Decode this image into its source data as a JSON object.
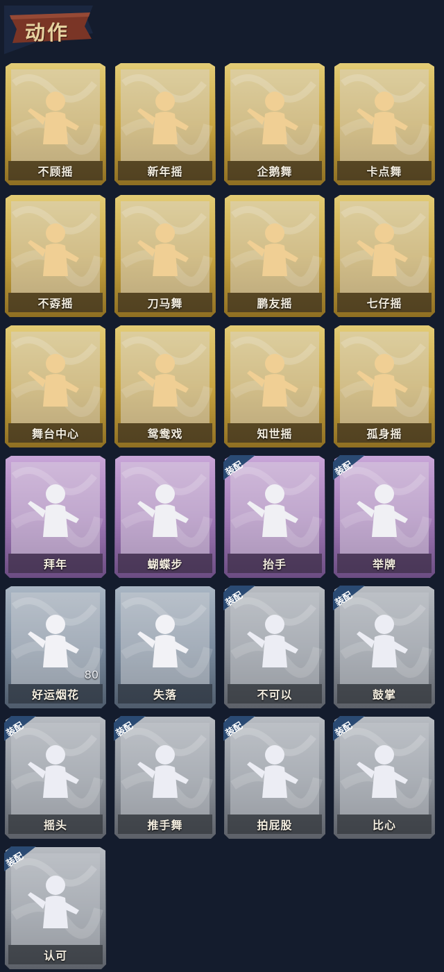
{
  "header": {
    "title": "动作"
  },
  "badge_text": "装配",
  "cards": [
    {
      "label": "不顾摇",
      "tier": "gold",
      "equipped": false,
      "icon": "dance-pose-arm-up-icon"
    },
    {
      "label": "新年摇",
      "tier": "gold",
      "equipped": false,
      "icon": "dance-pose-hands-clasp-icon"
    },
    {
      "label": "企鹅舞",
      "tier": "gold",
      "equipped": false,
      "icon": "dance-pose-penguin-icon"
    },
    {
      "label": "卡点舞",
      "tier": "gold",
      "equipped": false,
      "icon": "dance-pose-point-up-icon"
    },
    {
      "label": "不孬摇",
      "tier": "gold",
      "equipped": false,
      "icon": "dance-pose-wave-icon"
    },
    {
      "label": "刀马舞",
      "tier": "gold",
      "equipped": false,
      "icon": "dance-pose-cross-arms-icon"
    },
    {
      "label": "鹏友摇",
      "tier": "gold",
      "equipped": false,
      "icon": "dance-pose-wings-icon"
    },
    {
      "label": "七仔摇",
      "tier": "gold",
      "equipped": false,
      "icon": "dance-pose-arm-bent-icon"
    },
    {
      "label": "舞台中心",
      "tier": "gold",
      "equipped": false,
      "icon": "dance-pose-sparkle-icon"
    },
    {
      "label": "鸳鸯戏",
      "tier": "gold",
      "equipped": false,
      "icon": "dance-pose-notes-icon"
    },
    {
      "label": "知世摇",
      "tier": "gold",
      "equipped": false,
      "icon": "dance-pose-flame-icon"
    },
    {
      "label": "孤身摇",
      "tier": "gold",
      "equipped": false,
      "icon": "dance-pose-stars-icon"
    },
    {
      "label": "拜年",
      "tier": "purple",
      "equipped": false,
      "icon": "new-year-greeting-icon"
    },
    {
      "label": "蝴蝶步",
      "tier": "purple",
      "equipped": false,
      "icon": "butterfly-step-icon"
    },
    {
      "label": "抬手",
      "tier": "purple",
      "equipped": true,
      "icon": "raise-hand-icon"
    },
    {
      "label": "举牌",
      "tier": "purple",
      "equipped": true,
      "icon": "hold-sign-icon"
    },
    {
      "label": "好运烟花",
      "tier": "blue",
      "equipped": false,
      "icon": "firework-icon",
      "count": "80"
    },
    {
      "label": "失落",
      "tier": "blue",
      "equipped": false,
      "icon": "crawling-figure-icon"
    },
    {
      "label": "不可以",
      "tier": "gray",
      "equipped": true,
      "icon": "finger-wag-icon"
    },
    {
      "label": "鼓掌",
      "tier": "gray",
      "equipped": true,
      "icon": "clap-icon"
    },
    {
      "label": "摇头",
      "tier": "gray",
      "equipped": true,
      "icon": "shake-head-icon"
    },
    {
      "label": "推手舞",
      "tier": "gray",
      "equipped": true,
      "icon": "push-hand-dance-icon"
    },
    {
      "label": "拍屁股",
      "tier": "gray",
      "equipped": true,
      "icon": "slap-icon"
    },
    {
      "label": "比心",
      "tier": "gray",
      "equipped": true,
      "icon": "finger-heart-icon"
    },
    {
      "label": "认可",
      "tier": "gray",
      "equipped": true,
      "icon": "thumbs-up-icon"
    }
  ],
  "colors": {
    "background": "#141c2d",
    "gold": "#c9a642",
    "purple": "#a27bb8",
    "blue": "#7a8b9e",
    "gray": "#8e949c",
    "header_ribbon": "#7a3526"
  }
}
